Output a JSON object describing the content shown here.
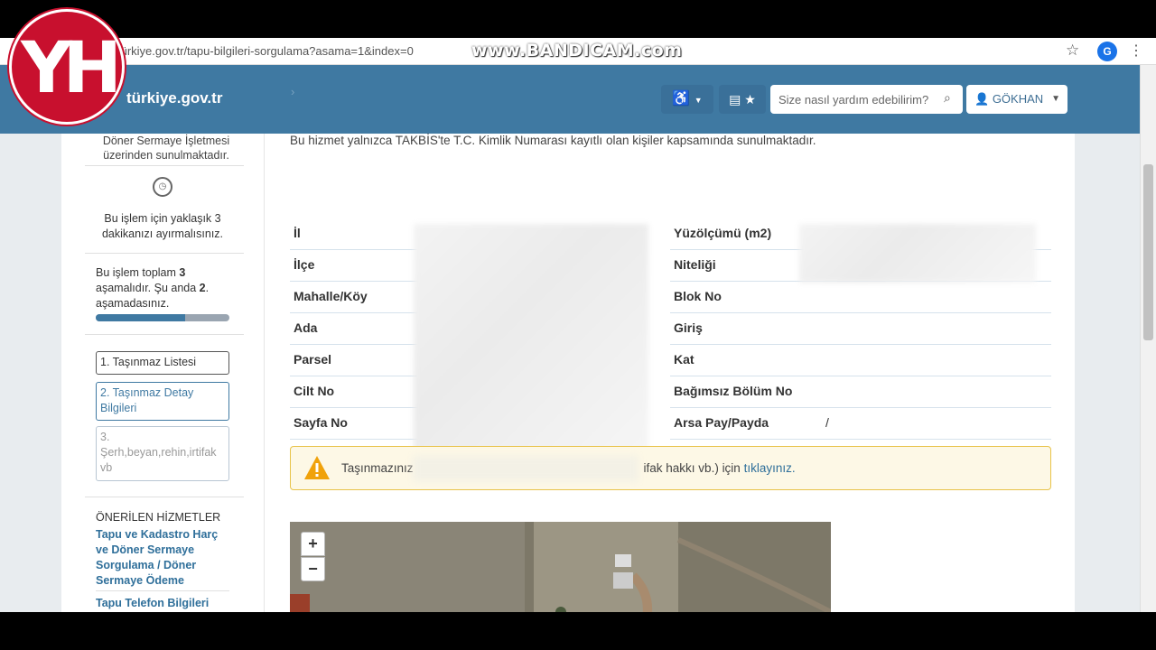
{
  "browser": {
    "url": "türkiye.gov.tr/tapu-bilgileri-sorgulama?asama=1&index=0",
    "watermark": "www.BANDICAM.com",
    "avatar_letter": "G"
  },
  "overlay_logo": {
    "text": "YH",
    "color": "#c8102e"
  },
  "header": {
    "site_name": "türkiye.gov.tr",
    "site_tagline": "",
    "search_placeholder": "Size nasıl yardım edebilirim?",
    "user_label": "GÖKHAN"
  },
  "sidebar": {
    "intro_lines": "Döner Sermaye İşletmesi üzerinden sunulmaktadır.",
    "time_text": "Bu işlem için yaklaşık 3 dakikanızı ayırmalısınız.",
    "steps_info": {
      "prefix": "Bu işlem toplam ",
      "total": "3",
      "middle": " aşamalıdır. Şu anda ",
      "current": "2",
      "suffix": ". aşamadasınız."
    },
    "progress_fraction": 0.67,
    "steps": [
      "1. Taşınmaz Listesi",
      "2. Taşınmaz Detay Bilgileri",
      "3. Şerh,beyan,rehin,irtifak vb"
    ],
    "recommended_title": "ÖNERİLEN HİZMETLER",
    "recommended_links": [
      "Tapu ve Kadastro Harç ve Döner Sermaye Sorgulama / Döner Sermaye Ödeme",
      "Tapu Telefon Bilgileri"
    ]
  },
  "main": {
    "notice": "Bu hizmet yalnızca TAKBİS'te T.C. Kimlik Numarası kayıtlı olan kişiler kapsamında sunulmaktadır.",
    "left_labels": [
      "İl",
      "İlçe",
      "Mahalle/Köy",
      "Ada",
      "Parsel",
      "Cilt No",
      "Sayfa No"
    ],
    "right_labels": [
      "Yüzölçümü (m2)",
      "Niteliği",
      "Blok No",
      "Giriş",
      "Kat",
      "Bağımsız Bölüm No",
      "Arsa Pay/Payda"
    ],
    "arsa_pay_value": "/",
    "warning": {
      "text_start": "Taşınmazınız",
      "text_end": "ifak hakkı vb.) için ",
      "link": "tıklayınız."
    },
    "map_zoom_in": "+",
    "map_zoom_out": "−"
  }
}
